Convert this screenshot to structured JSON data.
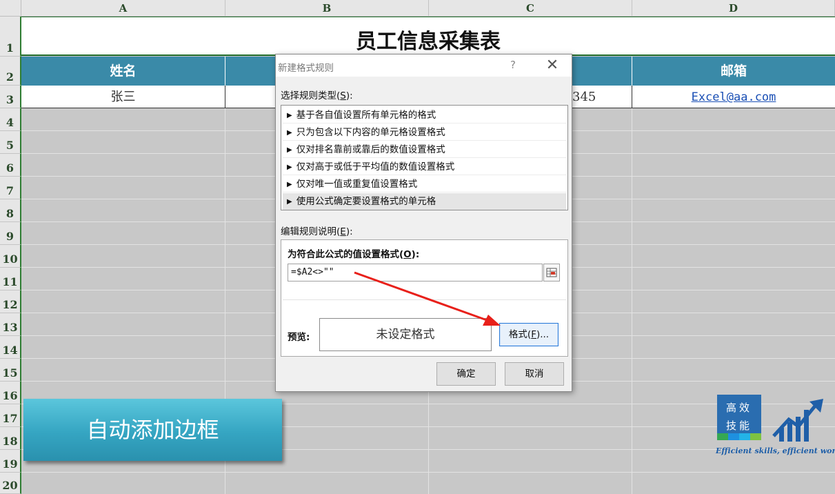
{
  "columns": [
    "A",
    "B",
    "C",
    "D"
  ],
  "rows": [
    "1",
    "2",
    "3",
    "4",
    "5",
    "6",
    "7",
    "8",
    "9",
    "10",
    "11",
    "12",
    "13",
    "14",
    "15",
    "16",
    "17",
    "18",
    "19",
    "20"
  ],
  "sheet": {
    "title": "员工信息采集表",
    "headers": {
      "a": "姓名",
      "d": "邮箱"
    },
    "row3": {
      "a": "张三",
      "c_partial": "345",
      "d": "Excel@aa.com"
    },
    "header_color": "#3a8aa8"
  },
  "shape_button": {
    "label": "自动添加边框"
  },
  "logo": {
    "line1": "高效",
    "line2": "技能",
    "caption": "Efficient skills, efficient work !"
  },
  "dialog": {
    "title": "新建格式规则",
    "help": "?",
    "close": "✕",
    "rule_type_label": "选择规则类型(",
    "rule_type_key": "S",
    "rule_type_label_end": "):",
    "rule_types": [
      "基于各自值设置所有单元格的格式",
      "只为包含以下内容的单元格设置格式",
      "仅对排名靠前或靠后的数值设置格式",
      "仅对高于或低于平均值的数值设置格式",
      "仅对唯一值或重复值设置格式",
      "使用公式确定要设置格式的单元格"
    ],
    "selected_index": 5,
    "edit_label": "编辑规则说明(",
    "edit_key": "E",
    "edit_label_end": "):",
    "formula_label": "为符合此公式的值设置格式(",
    "formula_key": "O",
    "formula_label_end": "):",
    "formula_value": "=$A2<>\"\"",
    "preview_label": "预览:",
    "preview_text": "未设定格式",
    "format_button": "格式(",
    "format_key": "F",
    "format_button_end": ")...",
    "ok": "确定",
    "cancel": "取消"
  },
  "annotation_color": "#e8201a"
}
